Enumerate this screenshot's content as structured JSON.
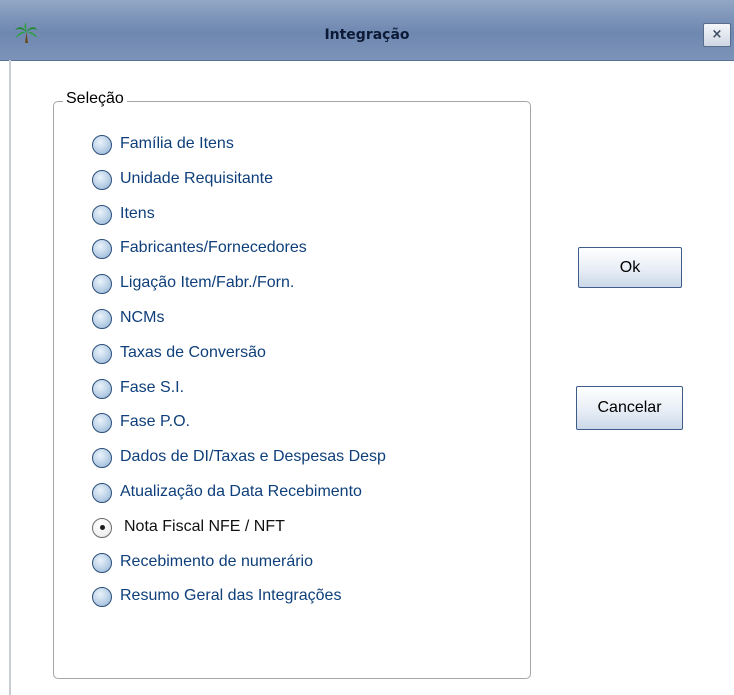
{
  "window": {
    "title": "Integração",
    "close_label": "×",
    "app_icon": "palm-tree-icon"
  },
  "selection_group": {
    "legend": "Seleção",
    "selected_index": 11,
    "options": [
      {
        "label": "Família de Itens",
        "checked": false
      },
      {
        "label": "Unidade Requisitante",
        "checked": false
      },
      {
        "label": "Itens",
        "checked": false
      },
      {
        "label": "Fabricantes/Fornecedores",
        "checked": false
      },
      {
        "label": "Ligação Item/Fabr./Forn.",
        "checked": false
      },
      {
        "label": "NCMs",
        "checked": false
      },
      {
        "label": "Taxas de Conversão",
        "checked": false
      },
      {
        "label": "Fase S.I.",
        "checked": false
      },
      {
        "label": "Fase P.O.",
        "checked": false
      },
      {
        "label": "Dados de DI/Taxas e Despesas Desp",
        "checked": false
      },
      {
        "label": "Atualização da Data Recebimento",
        "checked": false
      },
      {
        "label": "Nota Fiscal NFE / NFT",
        "checked": true
      },
      {
        "label": "Recebimento de numerário",
        "checked": false
      },
      {
        "label": "Resumo Geral das Integrações",
        "checked": false
      }
    ]
  },
  "buttons": {
    "ok_label": "Ok",
    "cancel_label": "Cancelar"
  },
  "colors": {
    "titlebar": "#7d94b9",
    "label_text": "#0e3f7a",
    "radio_fill": "#c3d7ea"
  }
}
